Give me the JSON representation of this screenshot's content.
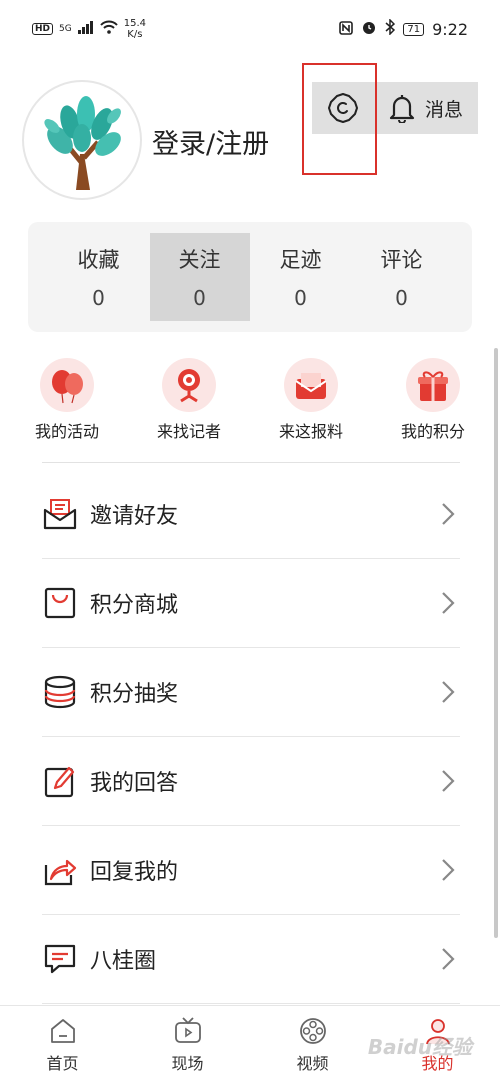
{
  "status_bar": {
    "hd": "HD",
    "signal": "5G",
    "speed_value": "15.4",
    "speed_unit": "K/s",
    "battery": "71",
    "time": "9:22"
  },
  "profile": {
    "login_text": "登录/注册",
    "messages_label": "消息"
  },
  "stats": [
    {
      "label": "收藏",
      "value": "0"
    },
    {
      "label": "关注",
      "value": "0"
    },
    {
      "label": "足迹",
      "value": "0"
    },
    {
      "label": "评论",
      "value": "0"
    }
  ],
  "quick_actions": [
    {
      "label": "我的活动",
      "icon": "balloons-icon"
    },
    {
      "label": "来找记者",
      "icon": "camera-icon"
    },
    {
      "label": "来这报料",
      "icon": "envelope-icon"
    },
    {
      "label": "我的积分",
      "icon": "gift-icon"
    }
  ],
  "menu": [
    {
      "label": "邀请好友",
      "icon": "invite-mail-icon"
    },
    {
      "label": "积分商城",
      "icon": "shopping-bag-icon"
    },
    {
      "label": "积分抽奖",
      "icon": "database-icon"
    },
    {
      "label": "我的回答",
      "icon": "edit-icon"
    },
    {
      "label": "回复我的",
      "icon": "share-reply-icon"
    },
    {
      "label": "八桂圈",
      "icon": "chat-icon"
    }
  ],
  "tabs": [
    {
      "label": "首页",
      "icon": "home-icon"
    },
    {
      "label": "现场",
      "icon": "tv-icon"
    },
    {
      "label": "视频",
      "icon": "film-reel-icon"
    },
    {
      "label": "我的",
      "icon": "user-icon",
      "active": true
    }
  ],
  "colors": {
    "accent": "#d9312b",
    "panel": "#f4f4f4",
    "highlight": "#e0e0e0"
  },
  "watermark": "Baidu经验"
}
